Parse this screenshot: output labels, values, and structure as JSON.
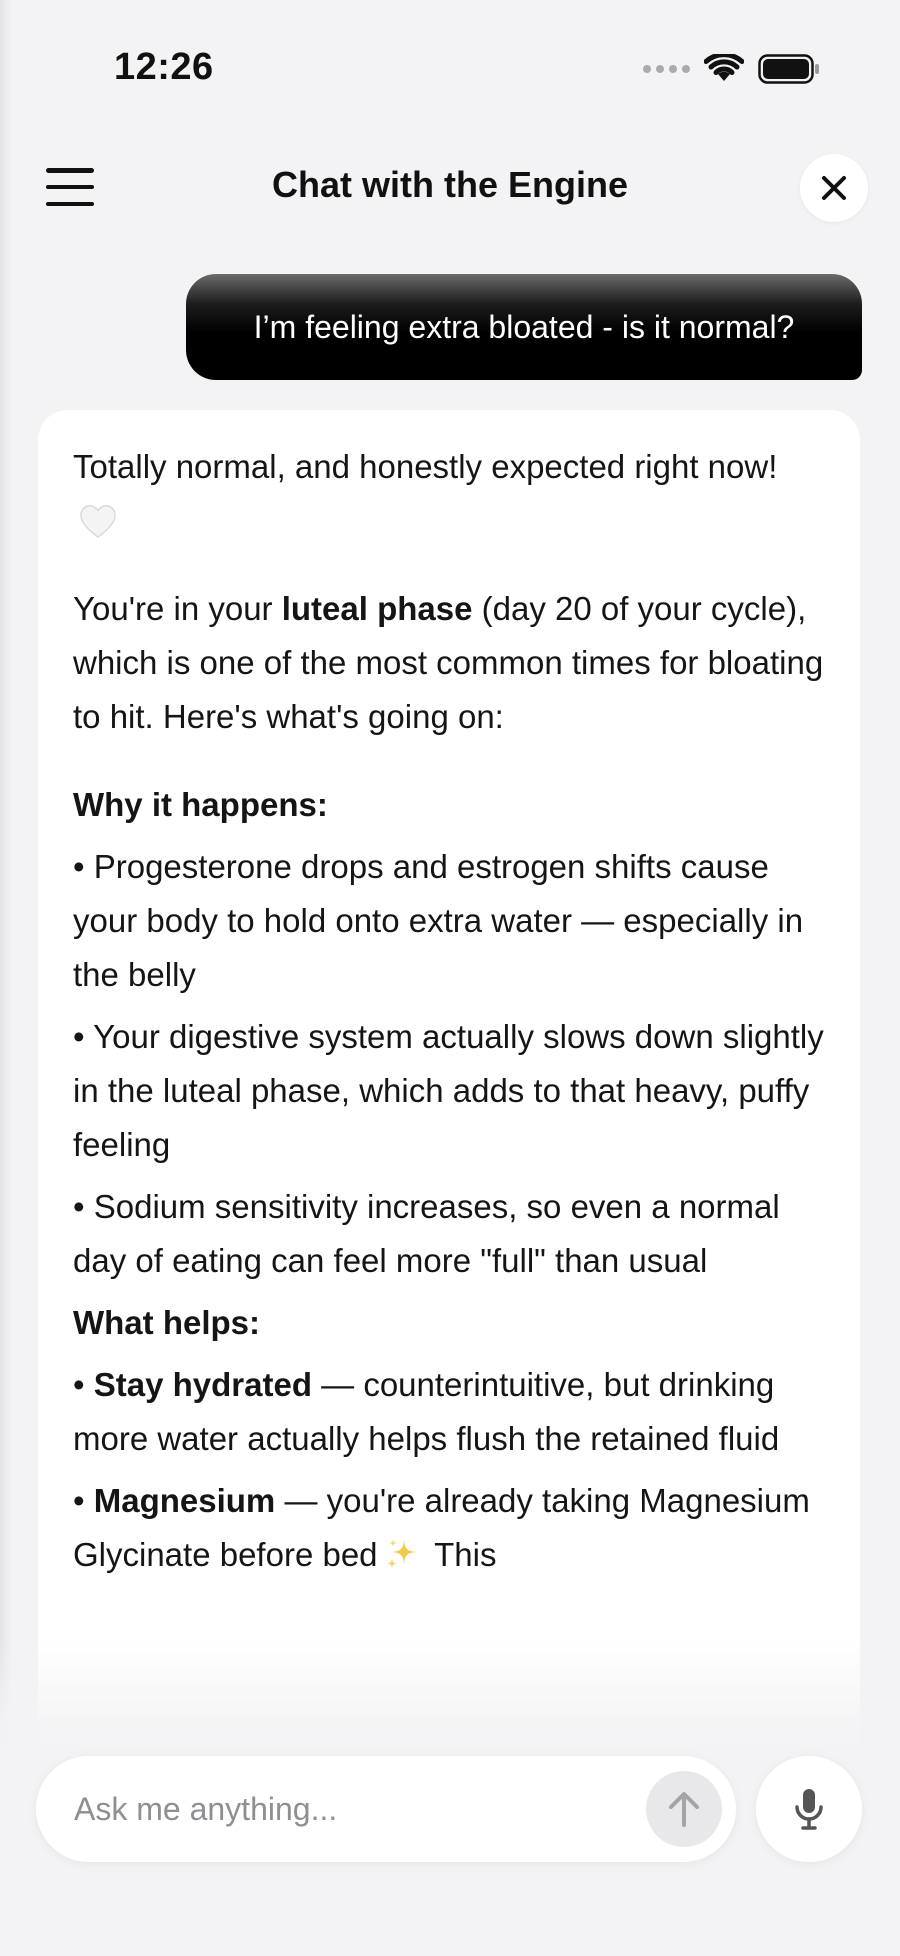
{
  "status_bar": {
    "time": "12:26",
    "icons": [
      "cellular-signal-icon",
      "wifi-icon",
      "battery-icon"
    ]
  },
  "header": {
    "title": "Chat with the Engine",
    "menu_icon": "hamburger-menu-icon",
    "close_icon": "close-icon"
  },
  "messages": {
    "user": {
      "text": "I’m feeling extra bloated - is it normal?"
    },
    "assistant": {
      "intro": "Totally normal, and honestly expected right now!",
      "intro_emoji": "white-heart-icon",
      "phase_pre": "You're in your ",
      "phase_bold": "luteal phase",
      "phase_post": " (day 20 of your cycle), which is one of the most common times for bloating to hit. Here's what's going on:",
      "why_heading": "Why it happens:",
      "why_bullets": [
        "• Progesterone drops and estrogen shifts cause your body to hold onto extra water — especially in the belly",
        "• Your digestive system actually slows down slightly in the luteal phase, which adds to that heavy, puffy feeling",
        "• Sodium sensitivity increases, so even a normal day of eating can feel more \"full\" than usual"
      ],
      "helps_heading": "What helps:",
      "helps_bullets": [
        {
          "prefix": "• ",
          "bold": "Stay hydrated",
          "text": " — counterintuitive, but drinking more water actually helps flush the retained fluid"
        },
        {
          "prefix": "• ",
          "bold": "Magnesium",
          "text": " — you're already taking Magnesium Glycinate before bed",
          "emoji": "sparkles-icon",
          "tail": " This"
        }
      ]
    }
  },
  "composer": {
    "placeholder": "Ask me anything...",
    "send_icon": "arrow-up-icon",
    "mic_icon": "microphone-icon"
  },
  "colors": {
    "background": "#f3f3f5",
    "card": "#ffffff",
    "user_bubble": "#000000",
    "text": "#111111",
    "placeholder": "#8e8e93"
  }
}
